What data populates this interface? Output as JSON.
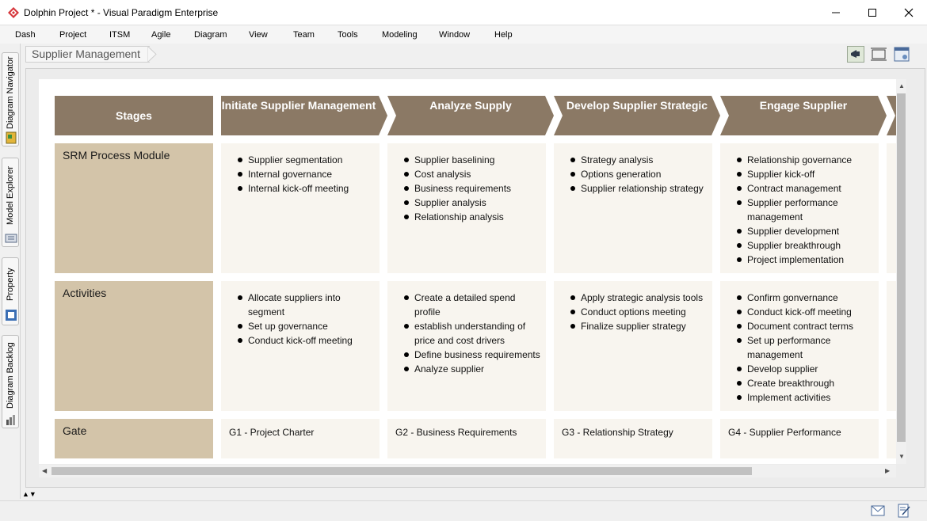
{
  "window": {
    "title": "Dolphin Project * - Visual Paradigm Enterprise",
    "app_icon": "visual-paradigm-logo",
    "minimize_icon": "minimize-icon",
    "maximize_icon": "maximize-icon",
    "close_icon": "close-icon"
  },
  "menu": {
    "items": [
      "Dash",
      "Project",
      "ITSM",
      "Agile",
      "Diagram",
      "View",
      "Team",
      "Tools",
      "Modeling",
      "Window",
      "Help"
    ]
  },
  "left_dock": {
    "tabs": [
      {
        "label": "Diagram Navigator",
        "icon": "diagram-navigator-icon"
      },
      {
        "label": "Model Explorer",
        "icon": "model-explorer-icon"
      },
      {
        "label": "Property",
        "icon": "property-icon"
      },
      {
        "label": "Diagram Backlog",
        "icon": "diagram-backlog-icon"
      }
    ]
  },
  "breadcrumb": {
    "label": "Supplier Management"
  },
  "toolbar_right": {
    "icons": [
      "announcement-icon",
      "fit-diagram-icon",
      "diagram-properties-icon"
    ]
  },
  "diagram": {
    "stages_label": "Stages",
    "stages": [
      "Initiate Supplier Management",
      "Analyze Supply",
      "Develop Supplier Strategic",
      "Engage Supplier"
    ],
    "rows": [
      {
        "label": "SRM Process Module",
        "cells": [
          [
            "Supplier segmentation",
            "Internal governance",
            "Internal kick-off meeting"
          ],
          [
            "Supplier baselining",
            "Cost analysis",
            "Business requirements",
            "Supplier analysis",
            "Relationship analysis"
          ],
          [
            "Strategy analysis",
            "Options generation",
            "Supplier relationship strategy"
          ],
          [
            "Relationship governance",
            "Supplier kick-off",
            "Contract management",
            "Supplier performance management",
            "Supplier development",
            "Supplier breakthrough",
            "Project implementation"
          ]
        ]
      },
      {
        "label": "Activities",
        "cells": [
          [
            "Allocate suppliers into segment",
            "Set up governance",
            "Conduct kick-off meeting"
          ],
          [
            "Create a detailed spend profile",
            "establish understanding of price and cost drivers",
            "Define business requirements",
            "Analyze supplier"
          ],
          [
            "Apply strategic analysis tools",
            "Conduct options meeting",
            "Finalize supplier strategy"
          ],
          [
            "Confirm gonvernance",
            "Conduct kick-off meeting",
            "Document contract terms",
            "Set up performance management",
            "Develop supplier",
            "Create breakthrough",
            "Implement activities"
          ]
        ]
      }
    ],
    "gate": {
      "label": "Gate",
      "values": [
        "G1 - Project Charter",
        "G2 - Business Requirements",
        "G3 - Relationship Strategy",
        "G4 - Supplier Performance"
      ]
    }
  },
  "status_bar": {
    "icons": [
      "mail-icon",
      "edit-document-icon"
    ]
  },
  "colors": {
    "stage_header": "#8b7965",
    "row_label": "#d3c4a9",
    "cell_bg": "#f8f5ef",
    "canvas": "#ffffff"
  }
}
